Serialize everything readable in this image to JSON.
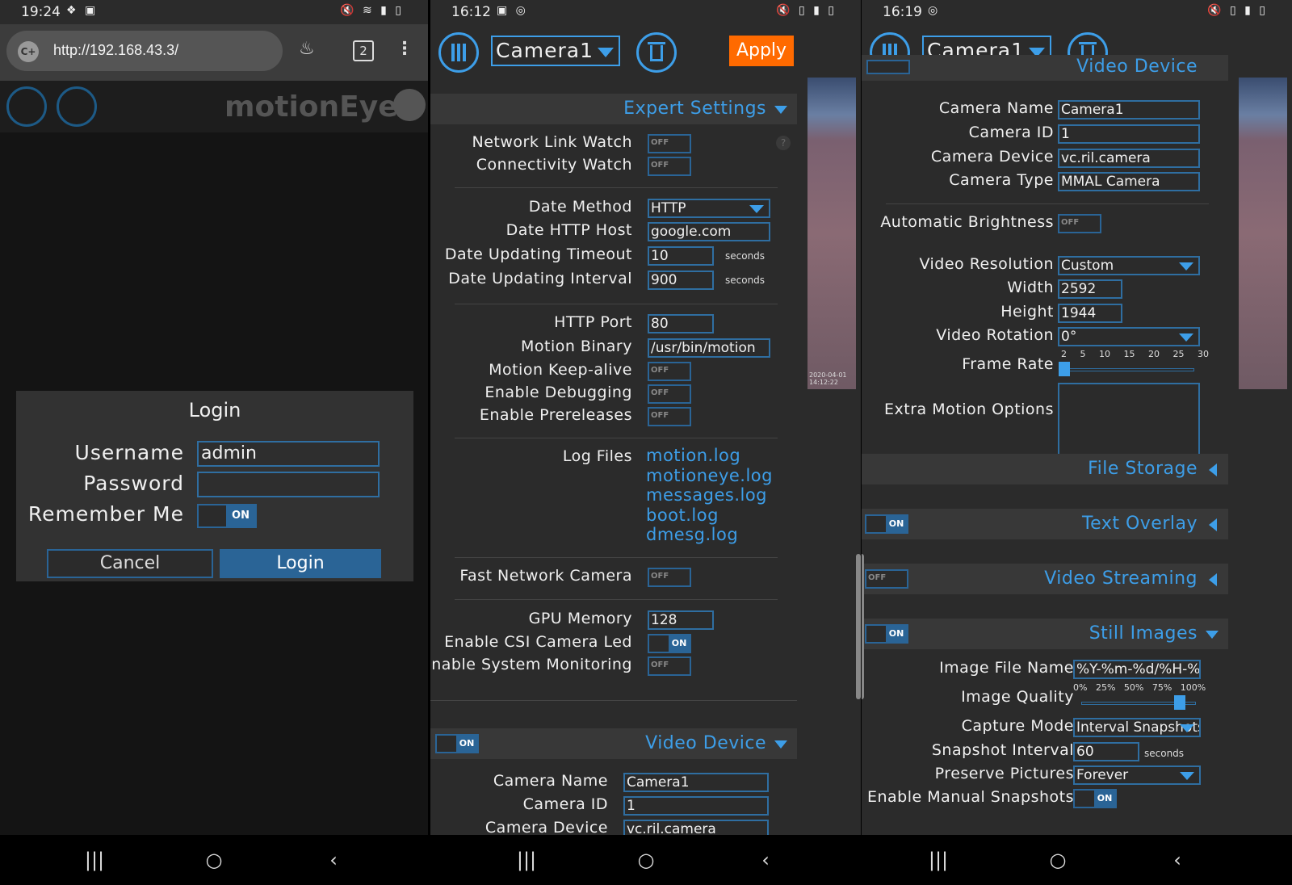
{
  "phone1": {
    "status": {
      "time": "19:24"
    },
    "browser": {
      "url": "http://192.168.43.3/",
      "tab_count": "2"
    },
    "header": {
      "brand": "motionEye"
    },
    "login": {
      "title": "Login",
      "username_label": "Username",
      "username_value": "admin",
      "password_label": "Password",
      "password_value": "",
      "remember_label": "Remember Me",
      "remember_state": "ON",
      "cancel_label": "Cancel",
      "login_label": "Login"
    }
  },
  "phone2": {
    "status": {
      "time": "16:12"
    },
    "camera": "Camera1",
    "apply_label": "Apply",
    "expert": {
      "title": "Expert Settings",
      "network_link_watch": {
        "label": "Network Link Watch",
        "state": "OFF"
      },
      "connectivity_watch": {
        "label": "Connectivity Watch",
        "state": "OFF"
      },
      "date_method": {
        "label": "Date Method",
        "value": "HTTP"
      },
      "date_http_host": {
        "label": "Date HTTP Host",
        "value": "google.com"
      },
      "date_updating_timeout": {
        "label": "Date Updating Timeout",
        "value": "10",
        "units": "seconds"
      },
      "date_updating_interval": {
        "label": "Date Updating Interval",
        "value": "900",
        "units": "seconds"
      },
      "http_port": {
        "label": "HTTP Port",
        "value": "80"
      },
      "motion_binary": {
        "label": "Motion Binary",
        "value": "/usr/bin/motion"
      },
      "motion_keepalive": {
        "label": "Motion Keep-alive",
        "state": "OFF"
      },
      "enable_debugging": {
        "label": "Enable Debugging",
        "state": "OFF"
      },
      "enable_prereleases": {
        "label": "Enable Prereleases",
        "state": "OFF"
      },
      "log_files_label": "Log Files",
      "log_files": [
        "motion.log",
        "motioneye.log",
        "messages.log",
        "boot.log",
        "dmesg.log"
      ],
      "fast_network_camera": {
        "label": "Fast Network Camera",
        "state": "OFF"
      },
      "gpu_memory": {
        "label": "GPU Memory",
        "value": "128"
      },
      "csi_camera_led": {
        "label": "Enable CSI Camera Led",
        "state": "ON"
      },
      "system_monitoring": {
        "label": "Enable System Monitoring",
        "state": "OFF"
      }
    },
    "video_device": {
      "title": "Video Device",
      "state": "ON",
      "camera_name": {
        "label": "Camera Name",
        "value": "Camera1"
      },
      "camera_id": {
        "label": "Camera ID",
        "value": "1"
      },
      "camera_device": {
        "label": "Camera Device",
        "value": "vc.ril.camera"
      }
    },
    "preview_timestamp": "2020-04-01 14:12:22"
  },
  "phone3": {
    "status": {
      "time": "16:19"
    },
    "camera": "Camera1",
    "partial_header": "Video Device",
    "camera_name": {
      "label": "Camera Name",
      "value": "Camera1"
    },
    "camera_id": {
      "label": "Camera ID",
      "value": "1"
    },
    "camera_device": {
      "label": "Camera Device",
      "value": "vc.ril.camera"
    },
    "camera_type": {
      "label": "Camera Type",
      "value": "MMAL Camera"
    },
    "auto_brightness": {
      "label": "Automatic Brightness",
      "state": "OFF"
    },
    "video_resolution": {
      "label": "Video Resolution",
      "value": "Custom"
    },
    "width": {
      "label": "Width",
      "value": "2592"
    },
    "height": {
      "label": "Height",
      "value": "1944"
    },
    "video_rotation": {
      "label": "Video Rotation",
      "value": "0°"
    },
    "frame_rate": {
      "label": "Frame Rate",
      "ticks": "2 5 10 15 20 25 30",
      "value": 2
    },
    "extra_motion_options": {
      "label": "Extra Motion Options",
      "value": ""
    },
    "sections": {
      "file_storage": {
        "title": "File Storage"
      },
      "text_overlay": {
        "title": "Text Overlay",
        "state": "ON"
      },
      "video_streaming": {
        "title": "Video Streaming",
        "state": "OFF"
      },
      "still_images": {
        "title": "Still Images",
        "state": "ON"
      }
    },
    "image_file_name": {
      "label": "Image File Name",
      "value": "%Y-%m-%d/%H-%"
    },
    "image_quality": {
      "label": "Image Quality",
      "ticks": "0% 25% 50% 75% 100%",
      "value": 85
    },
    "capture_mode": {
      "label": "Capture Mode",
      "value": "Interval Snapshots"
    },
    "snapshot_interval": {
      "label": "Snapshot Interval",
      "value": "60",
      "units": "seconds"
    },
    "preserve_pictures": {
      "label": "Preserve Pictures",
      "value": "Forever"
    },
    "manual_snapshots": {
      "label": "Enable Manual Snapshots",
      "state": "ON"
    }
  },
  "colors": {
    "accent": "#3d9ee8",
    "apply": "#ff6a00",
    "toggle_on": "#2a6496",
    "panel": "#2b2b2b"
  }
}
